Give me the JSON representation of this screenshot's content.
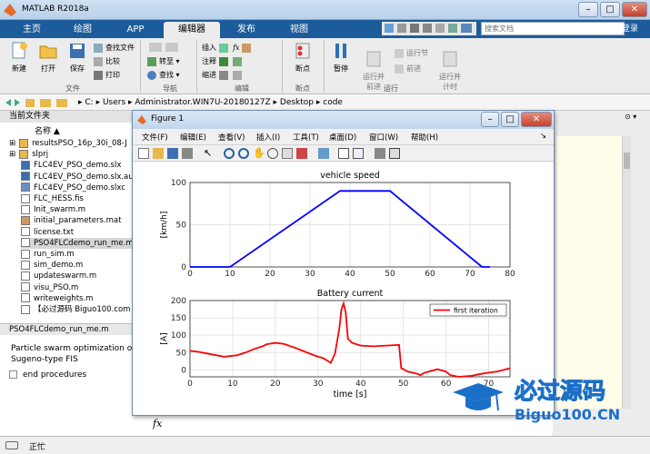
{
  "window": {
    "title": "MATLAB R2018a"
  },
  "tabs": [
    "主页",
    "绘图",
    "APP",
    "编辑器",
    "发布",
    "视图"
  ],
  "active_tab": "编辑器",
  "search": {
    "placeholder": "搜索文档"
  },
  "login": "登录",
  "ribbon": {
    "file": {
      "new": "新建",
      "open": "打开",
      "save": "保存",
      "find_files": "查找文件",
      "compare": "比较",
      "print": "打印",
      "group": "文件"
    },
    "nav": {
      "goto": "转至",
      "find": "查找",
      "group": "导航"
    },
    "edit": {
      "insert": "插入",
      "fx": "fx",
      "comment": "注释",
      "indent": "缩进",
      "group": "编辑"
    },
    "breakpoints": {
      "label": "断点",
      "group": "断点"
    },
    "run": {
      "pause": "暂停",
      "run_and_advance": "运行并\n前进",
      "run_section": "运行节",
      "advance": "前进",
      "run_and_time": "运行并\n计时",
      "group": "运行"
    }
  },
  "address": [
    "C:",
    "Users",
    "Administrator.WIN7U-20180127Z",
    "Desktop",
    "code"
  ],
  "left_panel": {
    "header": "当前文件夹",
    "column": "名称",
    "files": [
      {
        "name": "resultsPSO_16p_30i_08-J",
        "type": "folder"
      },
      {
        "name": "slprj",
        "type": "folder"
      },
      {
        "name": "FLC4EV_PSO_demo.slx",
        "type": "slx"
      },
      {
        "name": "FLC4EV_PSO_demo.slx.au",
        "type": "slx"
      },
      {
        "name": "FLC4EV_PSO_demo.slxc",
        "type": "slxc"
      },
      {
        "name": "FLC_HESS.fis",
        "type": "fis"
      },
      {
        "name": "Init_swarm.m",
        "type": "m"
      },
      {
        "name": "initial_parameters.mat",
        "type": "mat"
      },
      {
        "name": "license.txt",
        "type": "txt"
      },
      {
        "name": "PSO4FLCdemo_run_me.m",
        "type": "m",
        "selected": true
      },
      {
        "name": "run_sim.m",
        "type": "m"
      },
      {
        "name": "sim_demo.m",
        "type": "m"
      },
      {
        "name": "updateswarm.m",
        "type": "m"
      },
      {
        "name": "visu_PSO.m",
        "type": "m"
      },
      {
        "name": "writeweights.m",
        "type": "m"
      },
      {
        "name": "【必过源码 Biguo100.com",
        "type": "txt"
      }
    ],
    "detail_title": "PSO4FLCdemo_run_me.m",
    "detail_text_1": "Particle swarm optimization o",
    "detail_text_2": "Sugeno-type FIS",
    "detail_item": "end procedures"
  },
  "figure": {
    "title": "Figure 1",
    "menu": [
      "文件(F)",
      "编辑(E)",
      "查看(V)",
      "插入(I)",
      "工具(T)",
      "桌面(D)",
      "窗口(W)",
      "帮助(H)"
    ]
  },
  "chart_data": [
    {
      "type": "line",
      "title": "vehicle speed",
      "xlabel": "",
      "ylabel": "[km/h]",
      "xlim": [
        0,
        80
      ],
      "ylim": [
        0,
        100
      ],
      "xticks": [
        0,
        10,
        20,
        30,
        40,
        50,
        60,
        70,
        80
      ],
      "yticks": [
        0,
        50,
        100
      ],
      "grid": true,
      "series": [
        {
          "color": "#0000ff",
          "x": [
            0,
            10,
            37.5,
            50,
            73,
            75
          ],
          "y": [
            0,
            0,
            90,
            90,
            0,
            0
          ]
        }
      ]
    },
    {
      "type": "line",
      "title": "Battery current",
      "xlabel": "time [s]",
      "ylabel": "[A]",
      "xlim": [
        0,
        75
      ],
      "ylim": [
        -20,
        200
      ],
      "xticks": [
        0,
        10,
        20,
        30,
        40,
        50,
        60,
        70
      ],
      "yticks": [
        0,
        50,
        100,
        150,
        200
      ],
      "grid": true,
      "legend": "top-right",
      "series": [
        {
          "name": "first iteration",
          "color": "#ff0000",
          "x": [
            0,
            2,
            5,
            8,
            11,
            13,
            15,
            17,
            18,
            20,
            22,
            25,
            27,
            30,
            31,
            32,
            33,
            34,
            35,
            35.5,
            36,
            36.5,
            37,
            38,
            40,
            43,
            46,
            49,
            49.5,
            50,
            51,
            53,
            54,
            55,
            56,
            58,
            60,
            61,
            63,
            66,
            68,
            70,
            72,
            75
          ],
          "y": [
            55,
            52,
            45,
            38,
            42,
            50,
            60,
            68,
            74,
            78,
            75,
            62,
            52,
            38,
            35,
            28,
            20,
            48,
            120,
            175,
            192,
            165,
            90,
            78,
            70,
            68,
            70,
            72,
            5,
            2,
            -5,
            -10,
            -15,
            -8,
            -5,
            2,
            -5,
            -15,
            -20,
            -17,
            -12,
            -8,
            -5,
            5
          ]
        }
      ]
    }
  ],
  "status": "正忙",
  "watermark": {
    "text_cn": "必过源码",
    "text_en": "Biguo100.CN"
  },
  "colors": {
    "tab_strip": "#1d5c9a",
    "speed_line": "#0000ff",
    "current_line": "#ff0000"
  }
}
